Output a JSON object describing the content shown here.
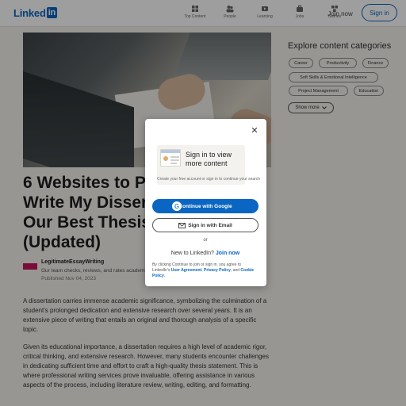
{
  "header": {
    "logo_text": "Linked",
    "logo_box": "in",
    "nav": [
      {
        "label": "Top Content",
        "icon": "top-content-icon"
      },
      {
        "label": "People",
        "icon": "people-icon"
      },
      {
        "label": "Learning",
        "icon": "learning-icon"
      },
      {
        "label": "Jobs",
        "icon": "jobs-icon"
      },
      {
        "label": "Games",
        "icon": "games-icon"
      }
    ],
    "join_label": "Join now",
    "signin_label": "Sign in"
  },
  "article": {
    "title": "6 Websites to Pay Someone to Write My Dissertation in 2025: Our Best Thesis Writers Picks (Updated)",
    "author_name": "LegitimateEssayWriting",
    "author_desc": "Our team checks, reviews, and rates academic writing services",
    "published": "Published Nov 04, 2023",
    "para1": "A dissertation carries immense academic significance, symbolizing the culmination of a student's prolonged dedication and extensive research over several years. It is an extensive piece of writing that entails an original and thorough analysis of a specific topic.",
    "para2": "Given its educational importance, a dissertation requires a high level of academic rigor, critical thinking, and extensive research. However, many students encounter challenges in dedicating sufficient time and effort to craft a high-quality thesis statement. This is where professional writing services prove invaluable, offering assistance in various aspects of the process, including literature review, writing, editing, and formatting."
  },
  "sidebar": {
    "title": "Explore content categories",
    "tags": [
      "Career",
      "Productivity",
      "Finance",
      "Soft Skills & Emotional Intelligence",
      "Project Management",
      "Education"
    ],
    "show_more": "Show more"
  },
  "modal": {
    "promo_title": "Sign in to view more content",
    "promo_sub": "Create your free account or sign in to continue your search",
    "google_label": "Continue with Google",
    "email_label": "Sign in with Email",
    "or": "or",
    "new_text": "New to LinkedIn?",
    "join_now": "Join now",
    "terms_pre": "By clicking Continue to join or sign in, you agree to LinkedIn's",
    "user_agreement": "User Agreement",
    "privacy_policy": "Privacy Policy",
    "and": "and",
    "cookie_policy": "Cookie Policy"
  },
  "colors": {
    "brand": "#0a66c2",
    "page_bg": "#f4f2ee"
  }
}
